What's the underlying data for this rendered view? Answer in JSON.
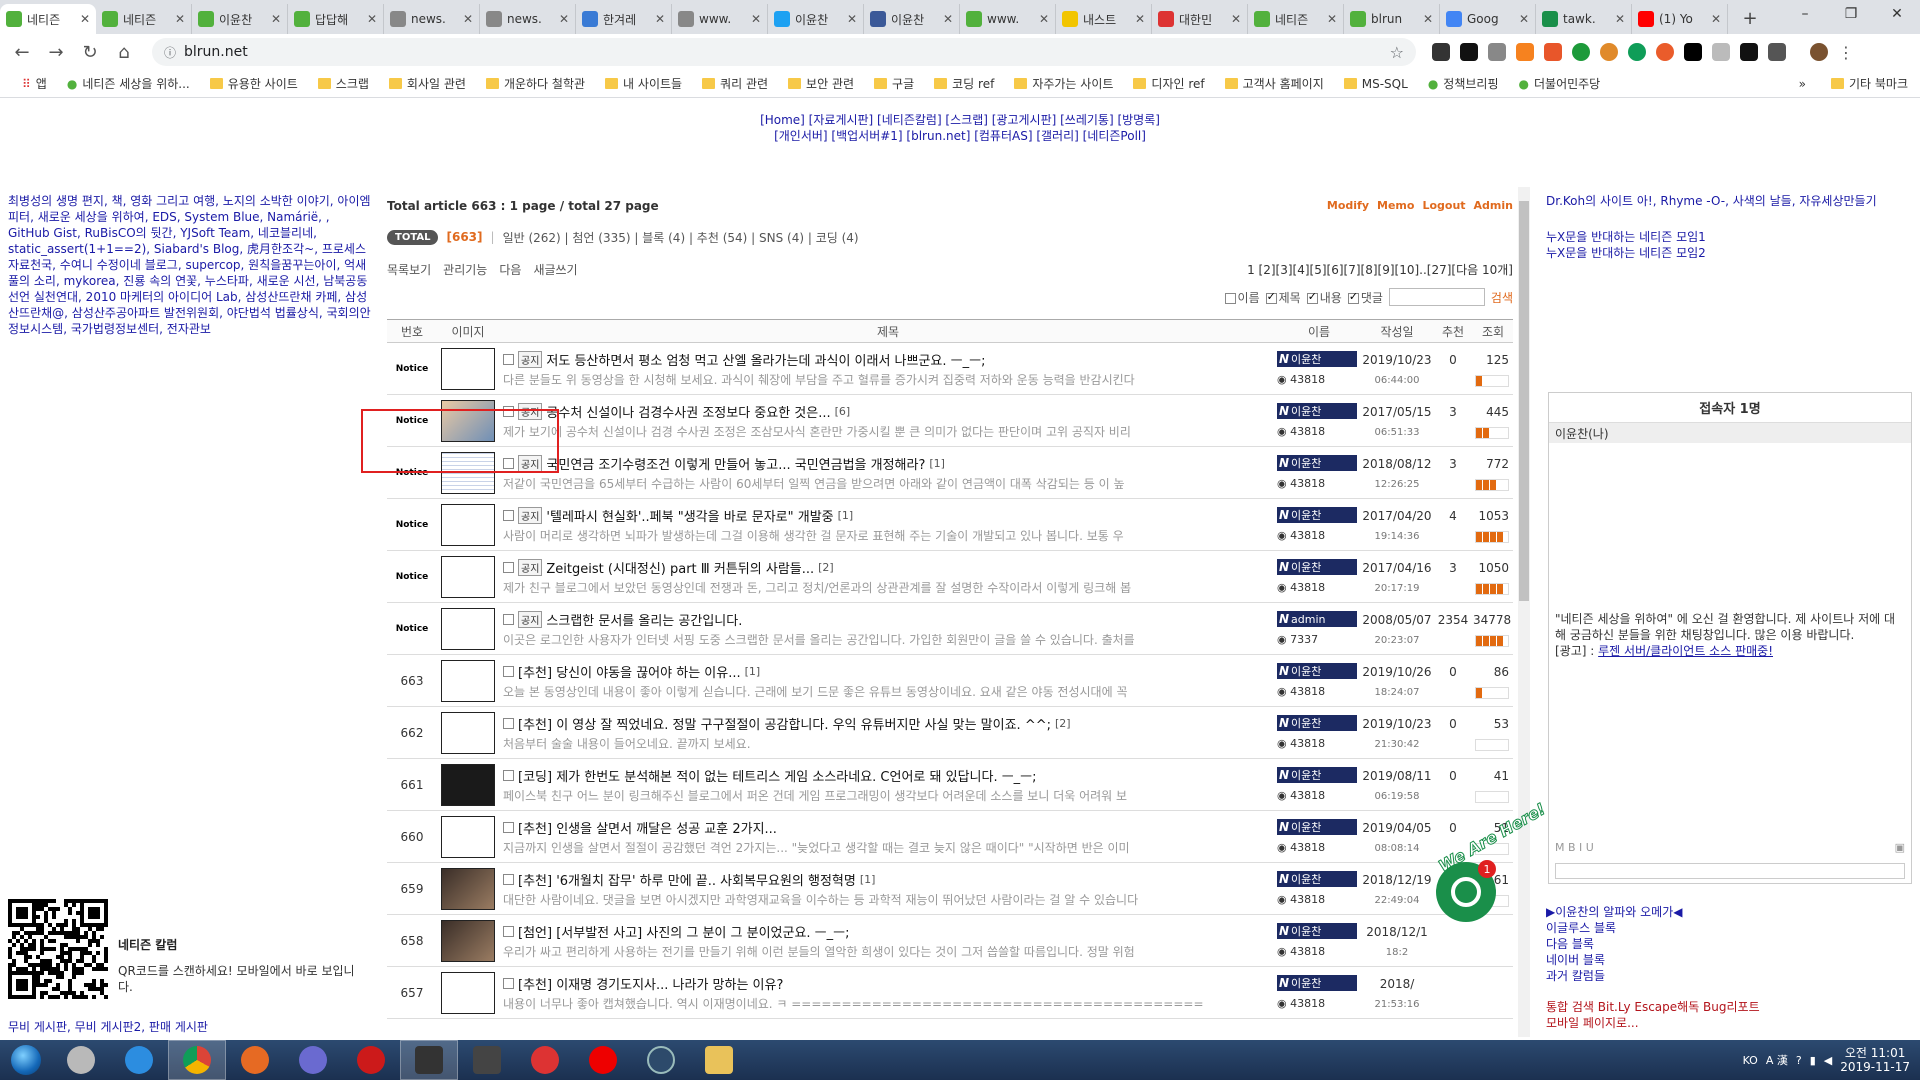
{
  "browser": {
    "tabs": [
      {
        "title": "네티즌",
        "color": "#52b13d",
        "active": true
      },
      {
        "title": "네티즌",
        "color": "#52b13d"
      },
      {
        "title": "이윤찬",
        "color": "#52b13d"
      },
      {
        "title": "답답해",
        "color": "#52b13d"
      },
      {
        "title": "news.",
        "color": "#888888"
      },
      {
        "title": "news.",
        "color": "#888888"
      },
      {
        "title": "한겨레",
        "color": "#3a7bd5"
      },
      {
        "title": "www.",
        "color": "#888888"
      },
      {
        "title": "이윤찬",
        "color": "#1da1f2"
      },
      {
        "title": "이윤찬",
        "color": "#3b5998"
      },
      {
        "title": "www.",
        "color": "#52b13d"
      },
      {
        "title": "내스트",
        "color": "#f2c500"
      },
      {
        "title": "대한민",
        "color": "#d33"
      },
      {
        "title": "네티즌",
        "color": "#52b13d"
      },
      {
        "title": "blrun",
        "color": "#52b13d"
      },
      {
        "title": "Goog",
        "color": "#4285f4"
      },
      {
        "title": "tawk.",
        "color": "#1a8f4a"
      },
      {
        "title": "(1) Yo",
        "color": "#ff0000"
      }
    ],
    "url": "blrun.net",
    "bookmarks": [
      {
        "label": "앱",
        "kind": "apps"
      },
      {
        "label": "네티즌 세상을 위하...",
        "kind": "site"
      },
      {
        "label": "유용한 사이트",
        "kind": "folder"
      },
      {
        "label": "스크랩",
        "kind": "folder"
      },
      {
        "label": "회사일 관련",
        "kind": "folder"
      },
      {
        "label": "개운하다 철학관",
        "kind": "folder"
      },
      {
        "label": "내 사이트들",
        "kind": "folder"
      },
      {
        "label": "쿼리 관련",
        "kind": "folder"
      },
      {
        "label": "보안 관련",
        "kind": "folder"
      },
      {
        "label": "구글",
        "kind": "folder"
      },
      {
        "label": "코딩 ref",
        "kind": "folder"
      },
      {
        "label": "자주가는 사이트",
        "kind": "folder"
      },
      {
        "label": "디자인 ref",
        "kind": "folder"
      },
      {
        "label": "고객사 홈페이지",
        "kind": "folder"
      },
      {
        "label": "MS-SQL",
        "kind": "folder"
      },
      {
        "label": "정책브리핑",
        "kind": "site"
      },
      {
        "label": "더불어민주당",
        "kind": "site"
      }
    ],
    "bookmark_more": "»",
    "other_bookmarks": "기타 북마크"
  },
  "menu": {
    "line1": "[Home] [자료게시판] [네티즌칼럼] [스크랩] [광고게시판] [쓰레기통] [방명록]",
    "line2": "[개인서버] [백업서버#1] [blrun.net] [컴퓨터AS] [갤러리] [네티즌Poll]"
  },
  "left": {
    "links": "최병성의 생명 편지, 책, 영화 그리고 여행, 노지의 소박한 이야기, 아이엠피터, 새로운 세상을 위하여, EDS, System Blue, Namárië, , GitHub Gist, RuBisCO의 뒷간, YJSoft Team, 네코블리네, static_assert(1+1==2), Siabard's Blog, 虎月한조각~, 프로세스 자료천국, 수여니 수정이네 블로그, supercop, 원칙을꿈꾸는아이, 억새풀의 소리, mykorea, 진룡 속의 연꽃, 누스타파, 새로운 시선, 남북공동선언 실천연대, 2010 마케터의 아이디어 Lab, 삼성산뜨란채 카페, 삼성산뜨란채@, 삼성산주공아파트 발전위원회, 야단법석 법률상식, 국회의안정보시스템, 국가법령정보센터, 전자관보",
    "qr_title": "네티즌 칼럼",
    "qr_sub": "QR코드를 스캔하세요! 모바일에서 바로 보입니다.",
    "bottom_links": "무비 게시판, 무비 게시판2, 판매 게시판"
  },
  "board": {
    "summary": "Total article 663 :  1 page / total 27 page",
    "admin_links": [
      "Modify",
      "Memo",
      "Logout",
      "Admin"
    ],
    "total_badge": "TOTAL",
    "total_count": "[663]",
    "categories": "일반 (262)  |  첨언 (335)  |  블록 (4)  |  추천 (54)  |  SNS (4)  |  코딩 (4)",
    "tools": [
      "목록보기",
      "관리기능",
      "다음",
      "새글쓰기"
    ],
    "pager": "1 [2][3][4][5][6][7][8][9][10]..[27][다음 10개]",
    "search_opts": [
      {
        "label": "이름",
        "checked": false
      },
      {
        "label": "제목",
        "checked": true
      },
      {
        "label": "내용",
        "checked": true
      },
      {
        "label": "댓글",
        "checked": true
      }
    ],
    "search_btn": "검색",
    "headers": [
      "번호",
      "이미지",
      "제목",
      "이름",
      "작성일",
      "추천",
      "조회"
    ],
    "rows": [
      {
        "no": "Notice",
        "thumb": "plain",
        "badge": "공지",
        "title": "저도 등산하면서 평소 엄청 먹고 산엘 올라가는데 과식이 이래서 나쁘군요. ㅡ_ㅡ;",
        "cmt": "",
        "preview": "다른 분들도 위 동영상을 한 시청해 보세요. 과식이 췌장에 부담을 주고 혈류를 증가시켜 집중력 저하와 운동 능력을 반감시킨다",
        "name": "이윤찬",
        "pts": "43818",
        "date": "2019/10/23",
        "time": "06:44:00",
        "rec": "0",
        "view": "125",
        "bars": 1
      },
      {
        "no": "Notice",
        "thumb": "photo",
        "badge": "공지",
        "title": "공수처 신설이나 검경수사권 조정보다 중요한 것은...",
        "cmt": "[6]",
        "preview": "제가 보기에 공수처 신설이나 검경 수사권 조정은 조삼모사식 혼란만 가중시킬 뿐 큰 의미가 없다는 판단이며 고위 공직자 비리",
        "name": "이윤찬",
        "pts": "43818",
        "date": "2017/05/15",
        "time": "06:51:33",
        "rec": "3",
        "view": "445",
        "bars": 2
      },
      {
        "no": "Notice",
        "thumb": "doc",
        "badge": "공지",
        "title": "국민연금 조기수령조건 이렇게 만들어 놓고... 국민연금법을 개정해라?",
        "cmt": "[1]",
        "preview": "저같이 국민연금을 65세부터 수급하는 사람이 60세부터 일찍 연금을 받으려면 아래와 같이 연금액이 대폭 삭감되는 등 이 높",
        "name": "이윤찬",
        "pts": "43818",
        "date": "2018/08/12",
        "time": "12:26:25",
        "rec": "3",
        "view": "772",
        "bars": 3
      },
      {
        "no": "Notice",
        "thumb": "plain",
        "badge": "공지",
        "title": "'텔레파시 현실화'..페북 \"생각을 바로 문자로\" 개발중",
        "cmt": "[1]",
        "preview": "사람이 머리로 생각하면 뇌파가 발생하는데 그걸 이용해 생각한 걸 문자로 표현해 주는 기술이 개발되고 있나 봅니다. 보통 우",
        "name": "이윤찬",
        "pts": "43818",
        "date": "2017/04/20",
        "time": "19:14:36",
        "rec": "4",
        "view": "1053",
        "bars": 4
      },
      {
        "no": "Notice",
        "thumb": "plain",
        "badge": "공지",
        "title": "Zeitgeist (시대정신) part Ⅲ 커튼뒤의 사람들...",
        "cmt": "[2]",
        "preview": "제가 친구 블로그에서 보았던 동영상인데 전쟁과 돈, 그리고 정치/언론과의 상관관계를 잘 설명한 수작이라서 이렇게 링크해 봅",
        "name": "이윤찬",
        "pts": "43818",
        "date": "2017/04/16",
        "time": "20:17:19",
        "rec": "3",
        "view": "1050",
        "bars": 4
      },
      {
        "no": "Notice",
        "thumb": "plain",
        "badge": "공지",
        "title": "스크랩한 문서를 올리는 공간입니다.",
        "cmt": "",
        "preview": "이곳은 로그인한 사용자가 인터넷 서핑 도중 스크랩한 문서를 올리는 공간입니다. 가입한 회원만이 글을 쓸 수 있습니다. 출처를",
        "name": "admin",
        "pts": "7337",
        "date": "2008/05/07",
        "time": "20:23:07",
        "rec": "2354",
        "view": "34778",
        "bars": 4
      },
      {
        "no": "663",
        "thumb": "plain",
        "badge": "",
        "title": "[추천] 당신이 야동을 끊어야 하는 이유...",
        "cmt": "[1]",
        "preview": "오늘 본 동영상인데 내용이 좋아 이렇게 싣습니다. 근래에 보기 드문 좋은 유튜브 동영상이네요. 요새 같은 야동 전성시대에 꼭",
        "name": "이윤찬",
        "pts": "43818",
        "date": "2019/10/26",
        "time": "18:24:07",
        "rec": "0",
        "view": "86",
        "bars": 1
      },
      {
        "no": "662",
        "thumb": "plain",
        "badge": "",
        "title": "[추천] 이 영상 잘 찍었네요. 정말 구구절절이 공감합니다. 우익 유튜버지만 사실 맞는 말이죠. ^^;",
        "cmt": "[2]",
        "preview": "처음부터 술술 내용이 들어오네요. 끝까지 보세요.",
        "name": "이윤찬",
        "pts": "43818",
        "date": "2019/10/23",
        "time": "21:30:42",
        "rec": "0",
        "view": "53",
        "bars": 0
      },
      {
        "no": "661",
        "thumb": "dark",
        "badge": "",
        "title": "[코딩] 제가 한번도 분석해본 적이 없는 테트리스 게임 소스라네요. C언어로 돼 있답니다. ㅡ_ㅡ;",
        "cmt": "",
        "preview": "페이스북 친구 어느 분이 링크해주신 블로그에서 퍼온 건데 게임 프로그래밍이 생각보다 어려운데 소스를 보니 더욱 어려워 보",
        "name": "이윤찬",
        "pts": "43818",
        "date": "2019/08/11",
        "time": "06:19:58",
        "rec": "0",
        "view": "41",
        "bars": 0
      },
      {
        "no": "660",
        "thumb": "plain",
        "badge": "",
        "title": "[추천] 인생을 살면서 깨달은 성공 교훈 2가지...",
        "cmt": "",
        "preview": "지금까지 인생을 살면서 절절이 공감했던 격언 2가지는... \"늦었다고 생각할 때는 결코 늦지 않은 때이다\" \"시작하면 반은 이미 ",
        "name": "이윤찬",
        "pts": "43818",
        "date": "2019/04/05",
        "time": "08:08:14",
        "rec": "0",
        "view": "51",
        "bars": 0
      },
      {
        "no": "659",
        "thumb": "photo2",
        "badge": "",
        "title": "[추천] '6개월치 잡무' 하루 만에 끝.. 사회복무요원의 행정혁명",
        "cmt": "[1]",
        "preview": "대단한 사람이네요. 댓글을 보면 아시겠지만 과학영재교육을 이수하는 등 과학적 재능이 뛰어났던 사람이라는 걸 알 수 있습니다",
        "name": "이윤찬",
        "pts": "43818",
        "date": "2018/12/19",
        "time": "22:49:04",
        "rec": "0",
        "view": "61",
        "bars": 0
      },
      {
        "no": "658",
        "thumb": "photo2",
        "badge": "",
        "title": "[첨언] [서부발전 사고] 사진의 그 분이 그 분이었군요. ㅡ_ㅡ;",
        "cmt": "",
        "preview": "우리가 싸고 편리하게 사용하는 전기를 만들기 위해 이런 분들의 열악한 희생이 있다는 것이 그저 씁쓸할 따름입니다. 정말 위험",
        "name": "이윤찬",
        "pts": "43818",
        "date": "2018/12/1",
        "time": "18:2",
        "rec": "",
        "view": "",
        "bars": 0
      },
      {
        "no": "657",
        "thumb": "plain",
        "badge": "",
        "title": "[추천] 이재명 경기도지사... 나라가 망하는 이유?",
        "cmt": "",
        "preview": "내용이 너무나 좋아 캡쳐했습니다. 역시 이재명이네요. ㅋ =========================================",
        "name": "이윤찬",
        "pts": "43818",
        "date": "2018/",
        "time": "21:53:16",
        "rec": "",
        "view": "",
        "bars": 0
      }
    ]
  },
  "right": {
    "top_links": "Dr.Koh의 사이트 아!, Rhyme -O-, 사색의 날들, 자유세상만들기",
    "links2": [
      "누X문을 반대하는 네티즌 모임1",
      "누X문을 반대하는 네티즌 모임2"
    ],
    "chat_title": "접속자 1명",
    "chat_user": "이윤찬(나)",
    "chat_welcome": "\"네티즌 세상을 위하여\" 에 오신 걸 환영합니다. 제 사이트나 저에 대해 궁금하신 분들을 위한 채팅창입니다. 많은 이용 바랍니다.",
    "chat_ad_label": "[광고] :",
    "chat_ad_link": "루젠 서버/클라이언트 소스 판매중!",
    "chat_tools": "M   B  I  U",
    "bottom_links": [
      "▶이윤찬의 알파와 오메가◀",
      "이글루스 블록",
      "다음 블록",
      "네이버 블록",
      "과거 칼럼들"
    ],
    "bottom_red": [
      "통합 검색 Bit.Ly Escape해독 Bug리포트",
      "모바일 페이지로..."
    ],
    "badge_count": "1",
    "we_are_here": "We Are Here!"
  },
  "taskbar": {
    "lang": "KO",
    "ime": "A 漢",
    "time": "오전 11:01",
    "date": "2019-11-17"
  },
  "colors": {
    "accent": "#e06a1e",
    "link": "#1a1aa6",
    "namebadge": "#1c2a62",
    "highlight": "#e02020"
  }
}
